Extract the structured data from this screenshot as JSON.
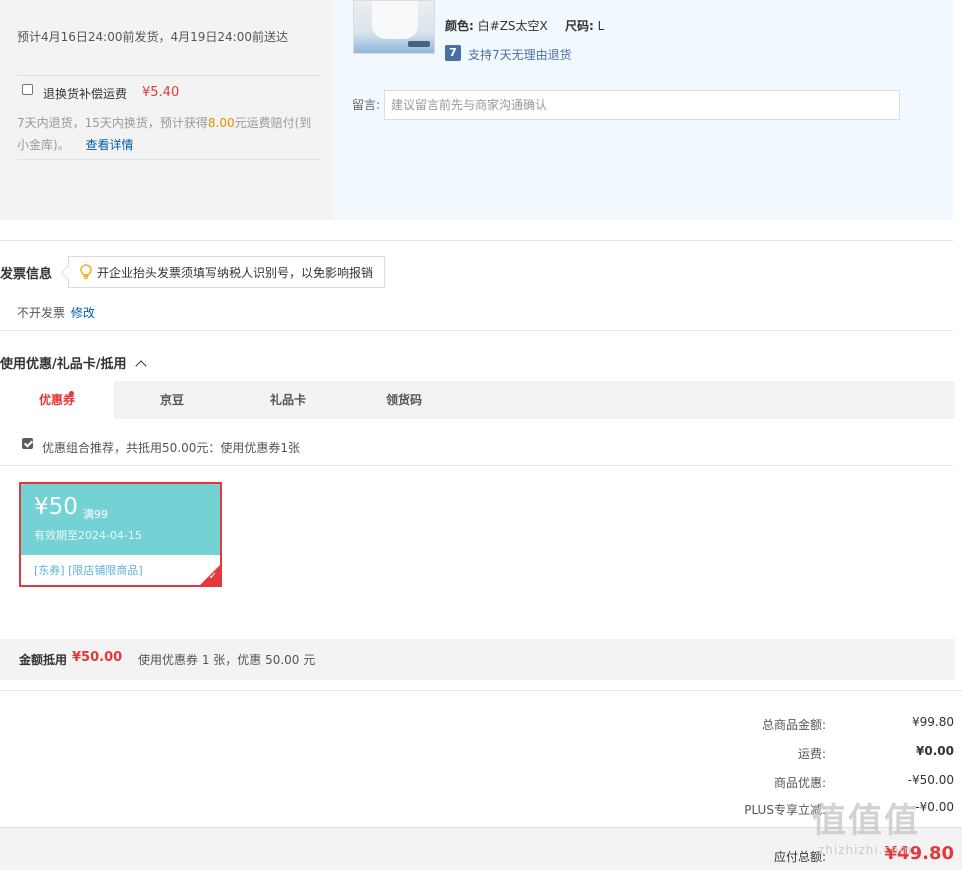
{
  "shipping": {
    "estimate": "预计4月16日24:00前发货，4月19日24:00前送达",
    "insurance_label": "退换货补偿运费",
    "insurance_price": "¥5.40",
    "insurance_desc_pre": "7天内退货，15天内换货，预计获得",
    "insurance_amount": "8.00",
    "insurance_desc_post": "元运费赔付(到小金库)。",
    "detail_link": "查看详情"
  },
  "product": {
    "color_label": "颜色:",
    "color_value": "白#ZS太空X",
    "size_label": "尺码:",
    "size_value": "L",
    "return_badge": "7",
    "return_text": "支持7天无理由退货",
    "message_label": "留言:",
    "message_placeholder": "建议留言前先与商家沟通确认"
  },
  "invoice": {
    "title": "发票信息",
    "tip": "开企业抬头发票须填写纳税人识别号，以免影响报销",
    "status": "不开发票",
    "edit_link": "修改"
  },
  "discount": {
    "title": "使用优惠/礼品卡/抵用",
    "tabs": [
      "优惠券",
      "京豆",
      "礼品卡",
      "领货码"
    ],
    "recommend_text": "优惠组合推荐，共抵用50.00元：使用优惠券1张",
    "coupon": {
      "amount": "¥50",
      "limit": "满99",
      "valid": "有效期至2024-04-15",
      "scope": "[东券] [限店铺限商品]"
    },
    "deduct_label": "金额抵用",
    "deduct_amount": "¥50.00",
    "deduct_desc": "使用优惠券 1 张，优惠 50.00 元"
  },
  "totals": {
    "goods_label": "总商品金额:",
    "goods_value": "¥99.80",
    "freight_label": "运费:",
    "freight_value": "¥0.00",
    "promo_label": "商品优惠:",
    "promo_value": "-¥50.00",
    "plus_label": "PLUS专享立减:",
    "plus_value": "-¥0.00",
    "payable_label": "应付总额:",
    "payable_value": "¥49.80"
  },
  "watermark": {
    "mark": "值值值",
    "site": "zhizhizhi.com"
  },
  "colors": {
    "accent_red": "#e4393c",
    "coupon_teal": "#74d2d4",
    "link_blue": "#005ea7",
    "orange": "#e28d00"
  }
}
